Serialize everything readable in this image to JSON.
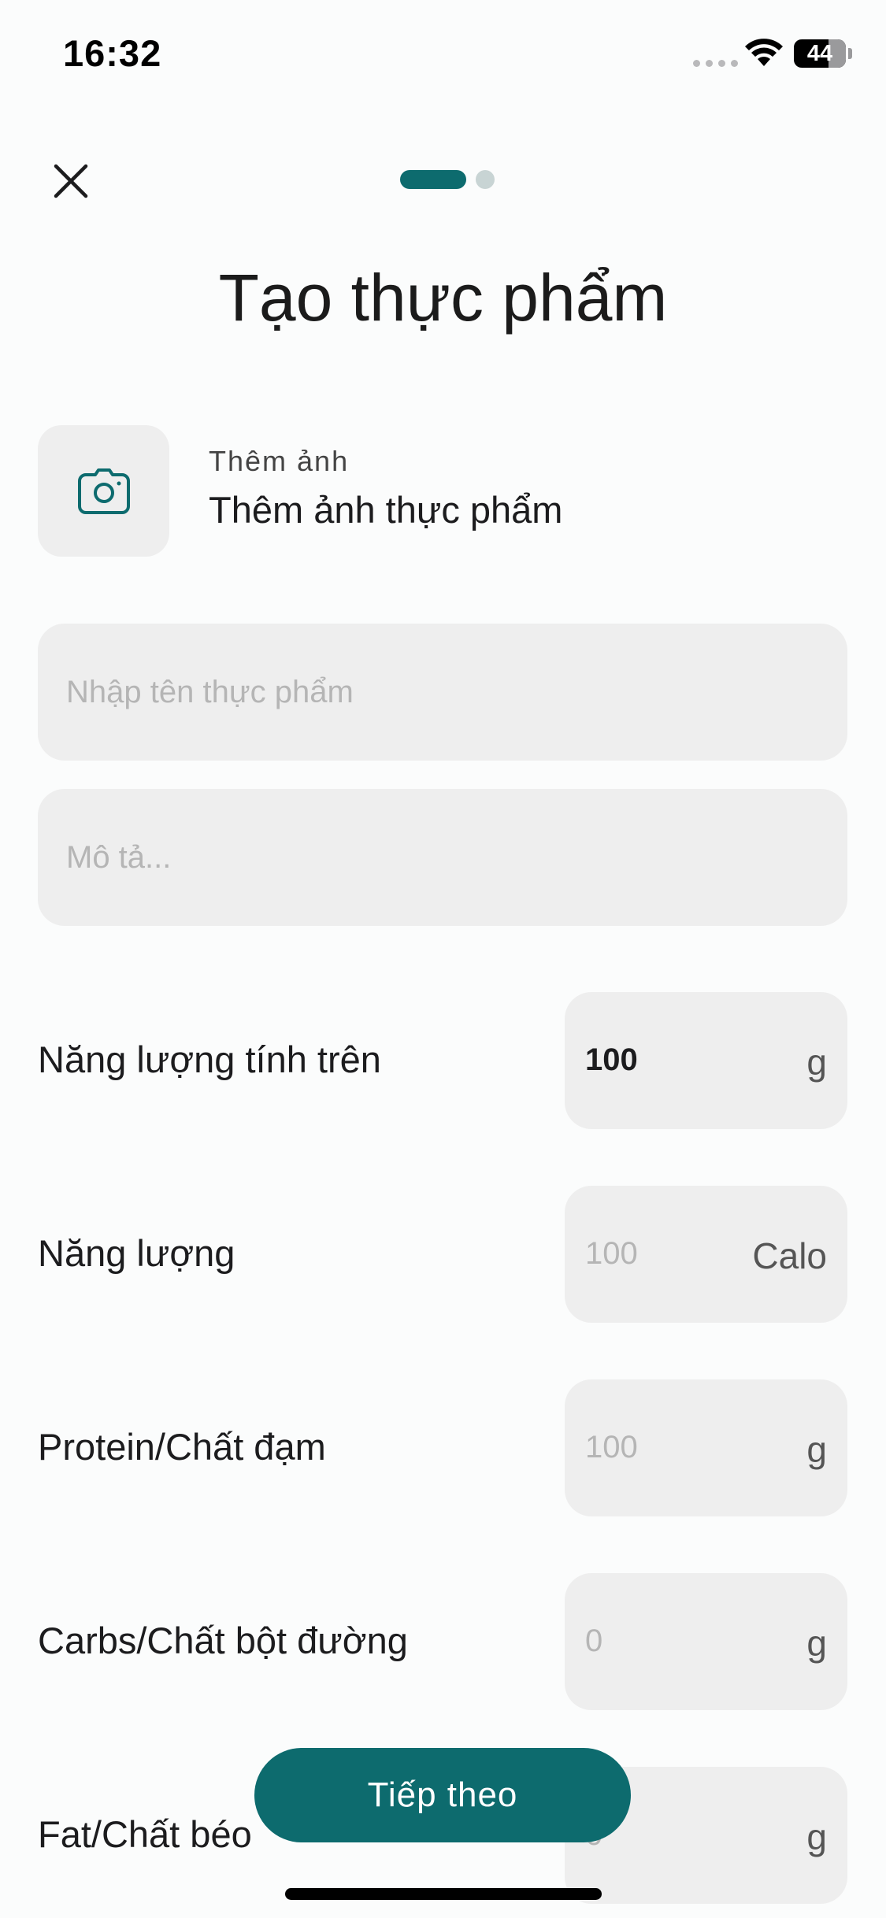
{
  "status_bar": {
    "time": "16:32",
    "battery": "44"
  },
  "header": {
    "title": "Tạo thực phẩm",
    "steps_total": 2,
    "step_current": 1
  },
  "photo": {
    "caption": "Thêm ảnh",
    "label": "Thêm ảnh thực phẩm"
  },
  "fields": {
    "name_placeholder": "Nhập tên thực phẩm",
    "description_placeholder": "Mô tả..."
  },
  "nutrition": [
    {
      "label": "Năng lượng tính trên",
      "value": "100",
      "unit": "g"
    },
    {
      "label": "Năng lượng",
      "value": "100",
      "unit": "Calo"
    },
    {
      "label": "Protein/Chất đạm",
      "value": "100",
      "unit": "g"
    },
    {
      "label": "Carbs/Chất bột đường",
      "value": "0",
      "unit": "g"
    },
    {
      "label": "Fat/Chất béo",
      "value": "0",
      "unit": "g"
    }
  ],
  "actions": {
    "next_label": "Tiếp theo"
  },
  "colors": {
    "accent": "#0d6b6e",
    "field_bg": "#eeeeee",
    "background": "#fbfcfc"
  }
}
